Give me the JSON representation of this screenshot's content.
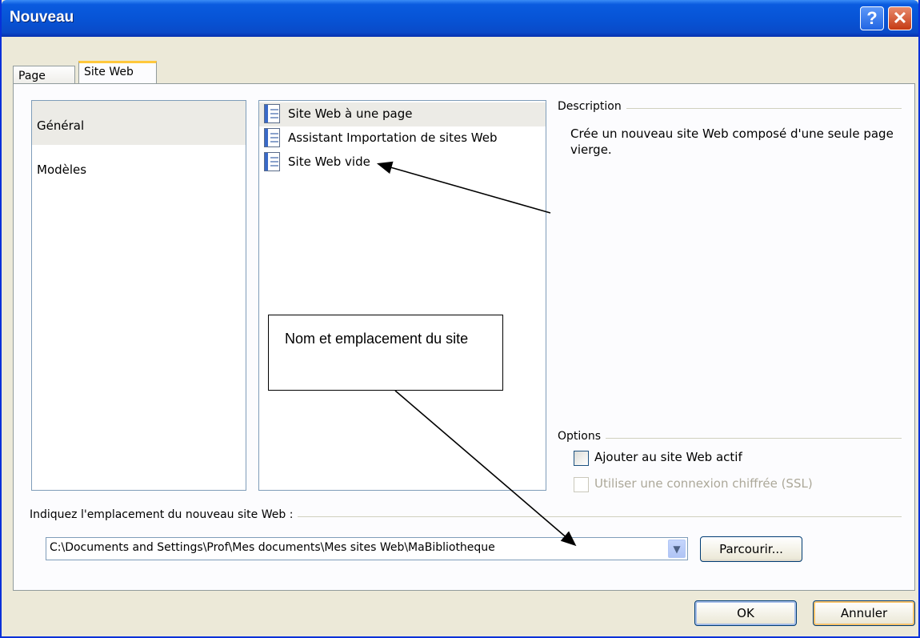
{
  "window": {
    "title": "Nouveau",
    "help_glyph": "?",
    "close_glyph": "✕"
  },
  "tabs": [
    {
      "label": "Page"
    },
    {
      "label": "Site Web"
    }
  ],
  "categories": [
    {
      "label": "Général"
    },
    {
      "label": "Modèles"
    }
  ],
  "templates": [
    {
      "label": "Site Web à une page",
      "icon": "web-page-icon"
    },
    {
      "label": "Assistant Importation de sites Web",
      "icon": "import-wizard-icon"
    },
    {
      "label": "Site Web vide",
      "icon": "empty-site-icon"
    }
  ],
  "description": {
    "heading": "Description",
    "text": "Crée un nouveau site Web composé d'une seule page vierge."
  },
  "options": {
    "heading": "Options",
    "add_to_current": "Ajouter au site Web actif",
    "ssl": "Utiliser une connexion chiffrée (SSL)"
  },
  "location": {
    "label": "Indiquez l'emplacement du nouveau site Web :",
    "value": "C:\\Documents and Settings\\Prof\\Mes documents\\Mes sites Web\\MaBibliotheque",
    "browse": "Parcourir..."
  },
  "buttons": {
    "ok": "OK",
    "cancel": "Annuler"
  },
  "annotation": {
    "text": "Nom et emplacement du site"
  },
  "colors": {
    "title_bar": "#0754d6",
    "dialog_bg": "#ece9d8",
    "tab_highlight": "#ffc83c"
  }
}
